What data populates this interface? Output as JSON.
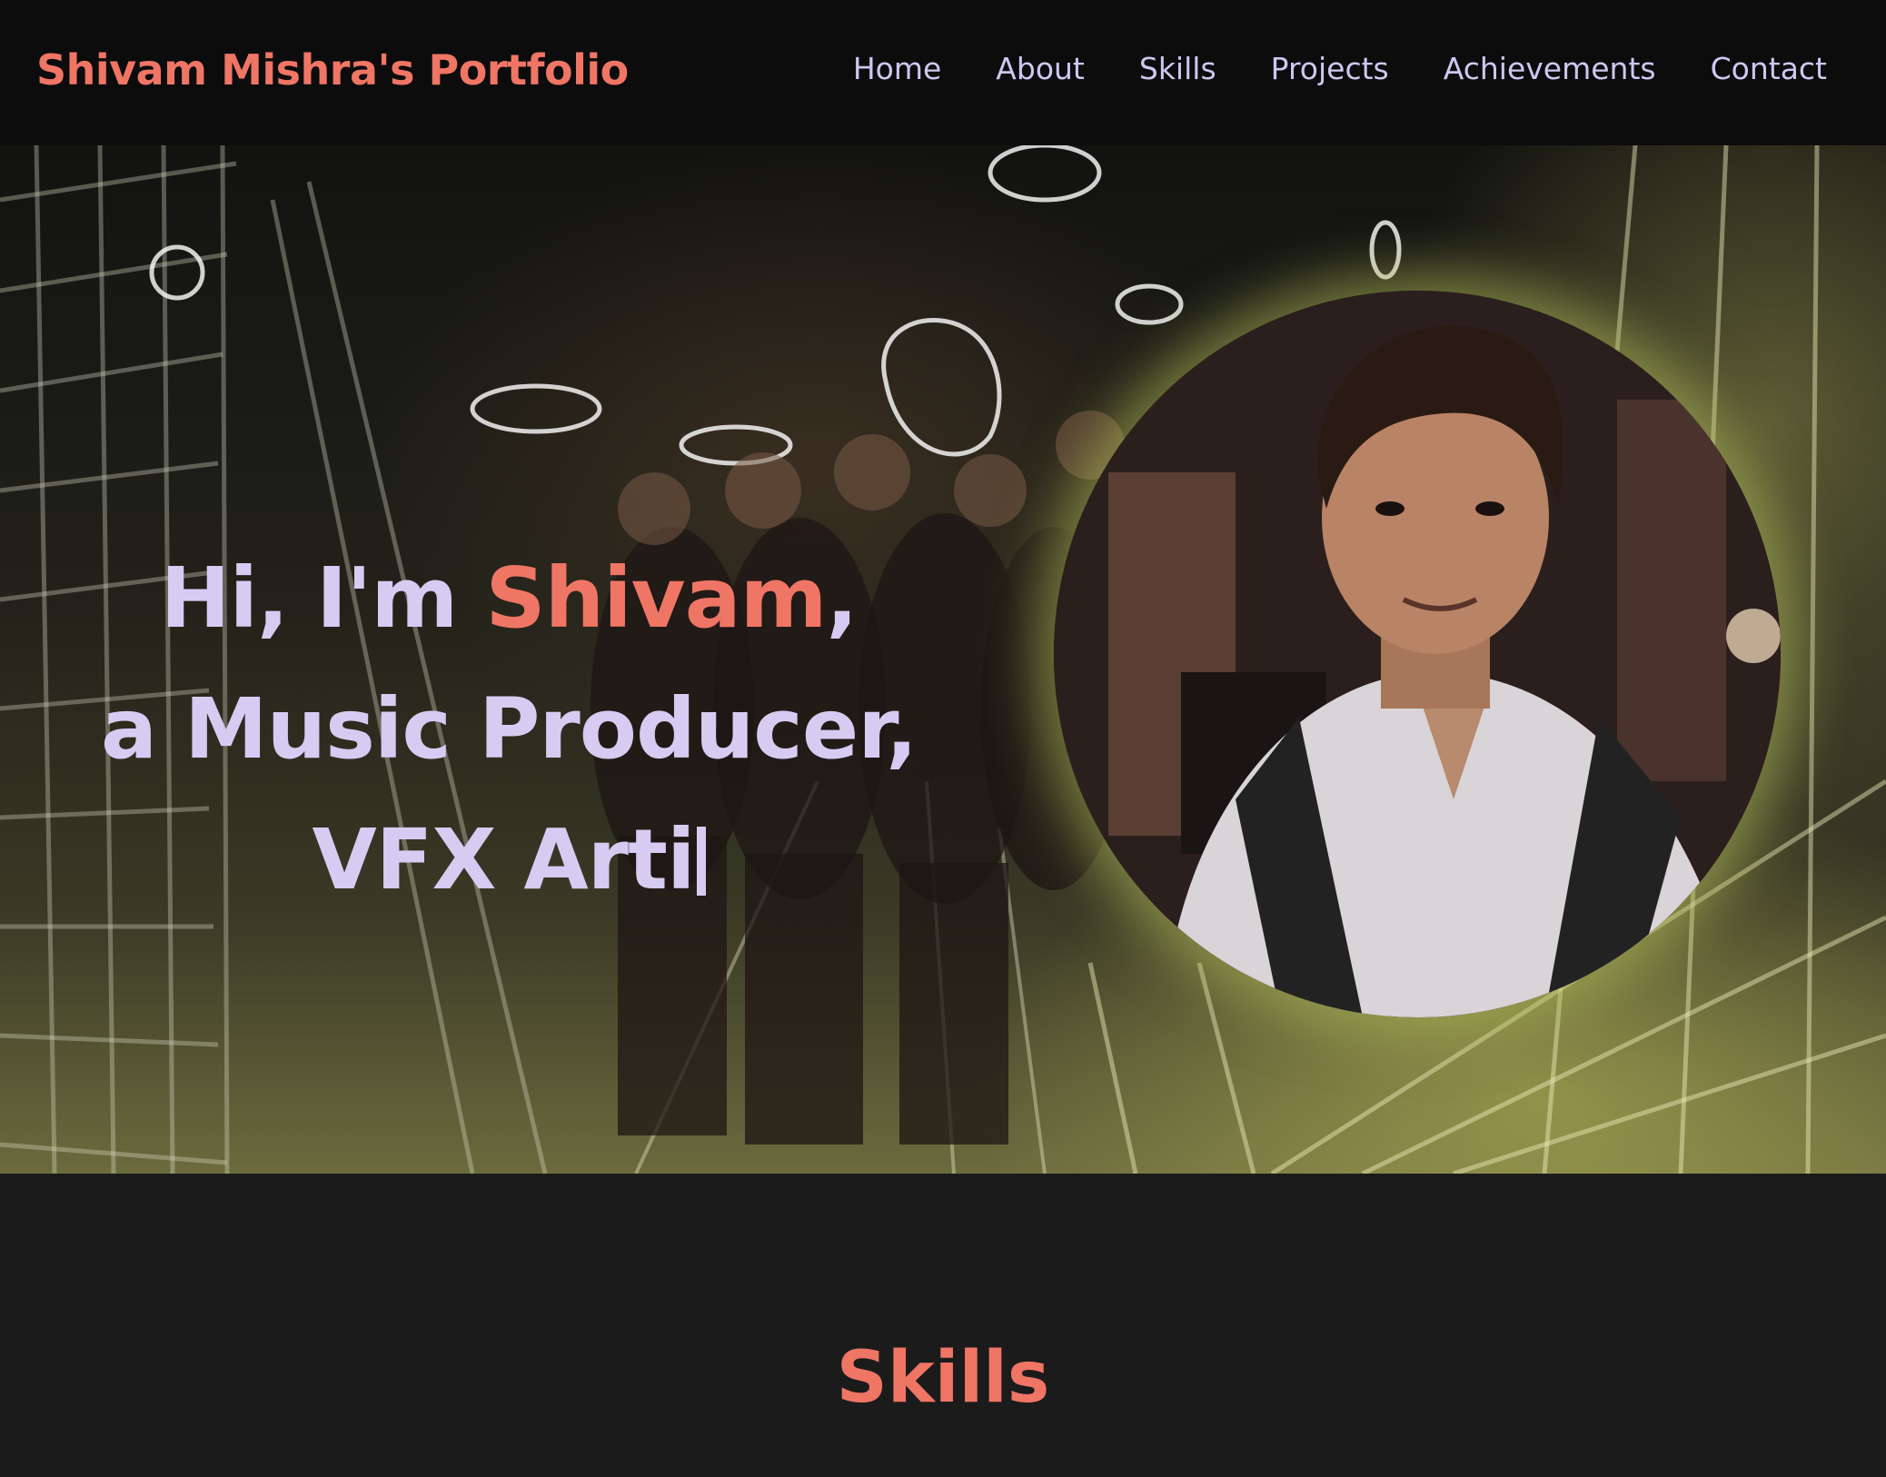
{
  "navbar": {
    "brand": "Shivam Mishra's Portfolio",
    "links": [
      {
        "label": "Home"
      },
      {
        "label": "About"
      },
      {
        "label": "Skills"
      },
      {
        "label": "Projects"
      },
      {
        "label": "Achievements"
      },
      {
        "label": "Contact"
      }
    ]
  },
  "hero": {
    "greeting_prefix": "Hi, I'm ",
    "greeting_name": "Shivam",
    "greeting_suffix": ",",
    "line2": "a Music Producer,",
    "line3": "VFX Arti"
  },
  "skills": {
    "title": "Skills"
  },
  "colors": {
    "accent": "#ef7565",
    "text_lavender": "#d6ccf2",
    "navbar_bg": "#0c0c0d",
    "section_bg": "#1b1b1b"
  }
}
